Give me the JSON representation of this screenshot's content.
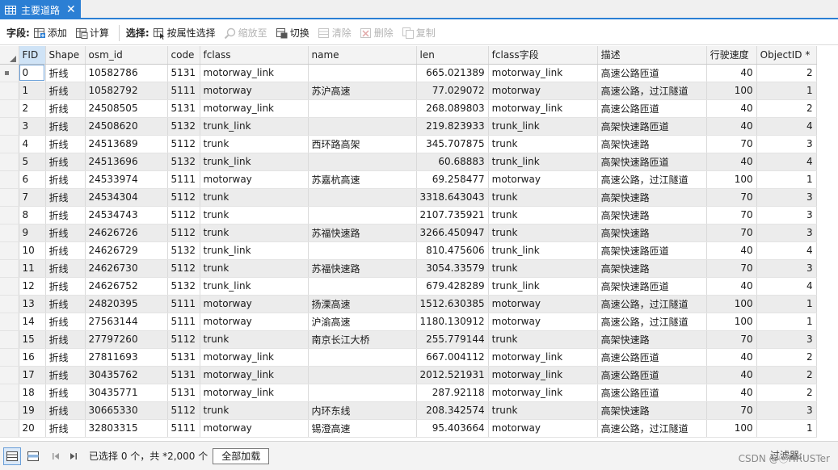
{
  "tab": {
    "title": "主要道路",
    "close": "✕"
  },
  "toolbar": {
    "field_label": "字段:",
    "add": "添加",
    "calculate": "计算",
    "select_label": "选择:",
    "select_by_attr": "按属性选择",
    "zoom_to": "缩放至",
    "switch": "切换",
    "clear": "清除",
    "delete": "删除",
    "copy": "复制"
  },
  "columns": [
    "FID",
    "Shape",
    "osm_id",
    "code",
    "fclass",
    "name",
    "len",
    "fclass字段",
    "描述",
    "行驶速度",
    "ObjectID *"
  ],
  "rows": [
    [
      "0",
      "折线",
      "10582786",
      "5131",
      "motorway_link",
      "",
      "665.021389",
      "motorway_link",
      "高速公路匝道",
      "40",
      "2"
    ],
    [
      "1",
      "折线",
      "10582792",
      "5111",
      "motorway",
      "苏沪高速",
      "77.029072",
      "motorway",
      "高速公路，过江隧道",
      "100",
      "1"
    ],
    [
      "2",
      "折线",
      "24508505",
      "5131",
      "motorway_link",
      "",
      "268.089803",
      "motorway_link",
      "高速公路匝道",
      "40",
      "2"
    ],
    [
      "3",
      "折线",
      "24508620",
      "5132",
      "trunk_link",
      "",
      "219.823933",
      "trunk_link",
      "高架快速路匝道",
      "40",
      "4"
    ],
    [
      "4",
      "折线",
      "24513689",
      "5112",
      "trunk",
      "西环路高架",
      "345.707875",
      "trunk",
      "高架快速路",
      "70",
      "3"
    ],
    [
      "5",
      "折线",
      "24513696",
      "5132",
      "trunk_link",
      "",
      "60.68883",
      "trunk_link",
      "高架快速路匝道",
      "40",
      "4"
    ],
    [
      "6",
      "折线",
      "24533974",
      "5111",
      "motorway",
      "苏嘉杭高速",
      "69.258477",
      "motorway",
      "高速公路，过江隧道",
      "100",
      "1"
    ],
    [
      "7",
      "折线",
      "24534304",
      "5112",
      "trunk",
      "",
      "3318.643043",
      "trunk",
      "高架快速路",
      "70",
      "3"
    ],
    [
      "8",
      "折线",
      "24534743",
      "5112",
      "trunk",
      "",
      "2107.735921",
      "trunk",
      "高架快速路",
      "70",
      "3"
    ],
    [
      "9",
      "折线",
      "24626726",
      "5112",
      "trunk",
      "苏福快速路",
      "3266.450947",
      "trunk",
      "高架快速路",
      "70",
      "3"
    ],
    [
      "10",
      "折线",
      "24626729",
      "5132",
      "trunk_link",
      "",
      "810.475606",
      "trunk_link",
      "高架快速路匝道",
      "40",
      "4"
    ],
    [
      "11",
      "折线",
      "24626730",
      "5112",
      "trunk",
      "苏福快速路",
      "3054.33579",
      "trunk",
      "高架快速路",
      "70",
      "3"
    ],
    [
      "12",
      "折线",
      "24626752",
      "5132",
      "trunk_link",
      "",
      "679.428289",
      "trunk_link",
      "高架快速路匝道",
      "40",
      "4"
    ],
    [
      "13",
      "折线",
      "24820395",
      "5111",
      "motorway",
      "扬溧高速",
      "1512.630385",
      "motorway",
      "高速公路，过江隧道",
      "100",
      "1"
    ],
    [
      "14",
      "折线",
      "27563144",
      "5111",
      "motorway",
      "沪渝高速",
      "1180.130912",
      "motorway",
      "高速公路，过江隧道",
      "100",
      "1"
    ],
    [
      "15",
      "折线",
      "27797260",
      "5112",
      "trunk",
      "南京长江大桥",
      "255.779144",
      "trunk",
      "高架快速路",
      "70",
      "3"
    ],
    [
      "16",
      "折线",
      "27811693",
      "5131",
      "motorway_link",
      "",
      "667.004112",
      "motorway_link",
      "高速公路匝道",
      "40",
      "2"
    ],
    [
      "17",
      "折线",
      "30435762",
      "5131",
      "motorway_link",
      "",
      "2012.521931",
      "motorway_link",
      "高速公路匝道",
      "40",
      "2"
    ],
    [
      "18",
      "折线",
      "30435771",
      "5131",
      "motorway_link",
      "",
      "287.92118",
      "motorway_link",
      "高速公路匝道",
      "40",
      "2"
    ],
    [
      "19",
      "折线",
      "30665330",
      "5112",
      "trunk",
      "内环东线",
      "208.342574",
      "trunk",
      "高架快速路",
      "70",
      "3"
    ],
    [
      "20",
      "折线",
      "32803315",
      "5111",
      "motorway",
      "锡澄高速",
      "95.403664",
      "motorway",
      "高速公路，过江隧道",
      "100",
      "1"
    ]
  ],
  "status": {
    "selection": "已选择 0 个，共 *2,000 个",
    "load_all": "全部加载",
    "filter": "过滤器:",
    "watermark": "CSDN @ⓒHRUSTer"
  },
  "colors": {
    "accent": "#2b7fd4"
  }
}
